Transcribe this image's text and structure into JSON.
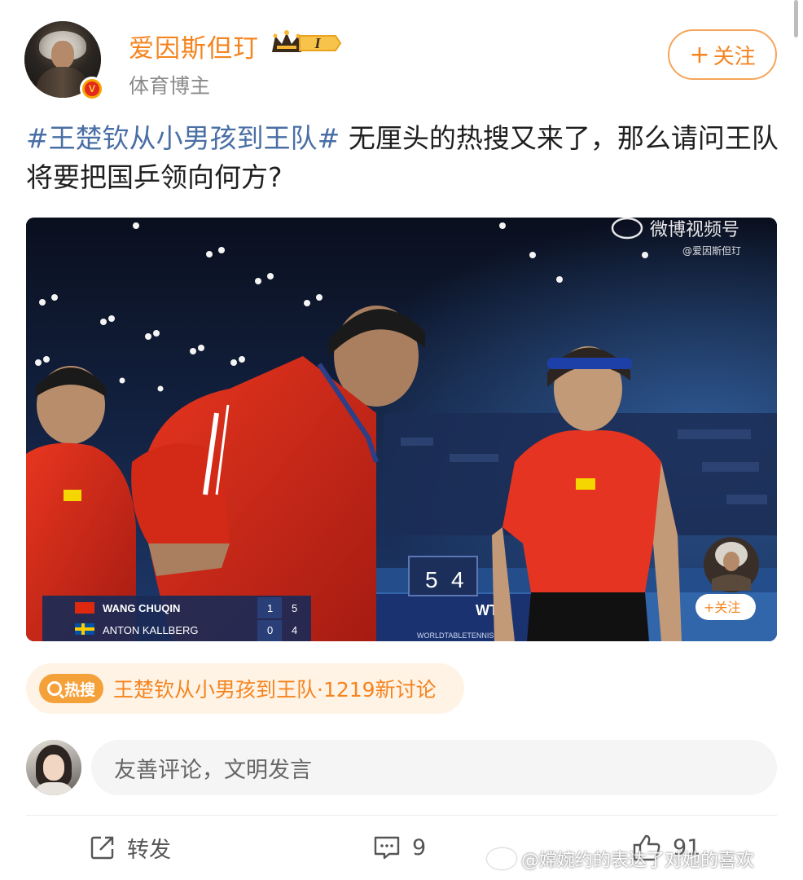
{
  "post": {
    "author": {
      "name": "爱因斯但玎",
      "subtitle": "体育博主",
      "level_badge": "I",
      "verified_icon": "v-verified-icon"
    },
    "follow_label": "关注",
    "follow_icon": "+",
    "text": {
      "topic": "#王楚钦从小男孩到王队#",
      "body": "无厘头的热搜又来了，那么请问王队将要把国乒领向何方?"
    },
    "video": {
      "watermark_brand": "微博视频号",
      "watermark_handle": "@爱因斯但玎",
      "overlay_follow": "+关注",
      "scoreboard": {
        "rows": [
          {
            "player": "WANG CHUQIN",
            "games": "1",
            "points": "5"
          },
          {
            "player": "ANTON KALLBERG",
            "games": "0",
            "points": "4"
          }
        ],
        "big_score_left": "5",
        "big_score_right": "4",
        "sponsor": "WTT",
        "site": "WORLDTABLETENNIS.COM"
      }
    },
    "hot_search": {
      "tag_label": "热搜",
      "text": "王楚钦从小男孩到王队·1219新讨论"
    }
  },
  "comment_box": {
    "placeholder": "友善评论，文明发言"
  },
  "actions": {
    "forward_label": "转发",
    "comment_count": "9",
    "like_count": "91"
  },
  "footer_watermark": "@嫦婉约的表达了对她的喜欢",
  "colors": {
    "accent_orange": "#f5841f",
    "topic_blue": "#4a6fa5",
    "hot_bg": "#fff3e6"
  }
}
